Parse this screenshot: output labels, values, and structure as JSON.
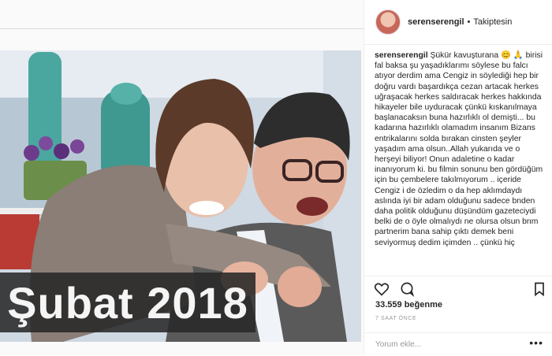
{
  "post": {
    "caption_banner": "Şubat 2018"
  },
  "author": {
    "username": "serenserengil",
    "separator": "•",
    "follow_status": "Takiptesin"
  },
  "comment": {
    "username": "serenserengil",
    "text": "Şükür kavuşturana 😊 🙏 birisi fal baksa şu yaşadıklarımı söylese bu falcı atıyor derdim ama Cengiz in söylediği hep bir doğru vardı başardıkça cezan artacak herkes uğraşacak herkes saldıracak herkes hakkında hikayeler bile uyduracak çünkü kıskanılmaya başlanacaksın buna hazırlıklı ol demişti... bu kadarına hazırlıklı olamadım insanım Bizans entrikalarını solda bırakan cinsten şeyler yaşadım ama olsun..Allah yukarıda ve o herşeyi biliyor! Onun adaletine o kadar inanıyorum ki. bu filmin sonunu ben gördüğüm için bu çembelere takılmıyorum .. içeride Cengiz i de özledim o da hep aklımdaydı aslında iyi bir adam olduğunu sadece bnden daha politik olduğunu düşündüm gazeteciydi belki de o öyle olmalıydı ne olursa olsun bnm partnerim bana sahip çıktı demek beni seviyormuş dedim içimden .. çünkü hiç"
  },
  "engagement": {
    "likes": "33.559 beğenme",
    "time": "7 SAAT ÖNCE"
  },
  "comment_input": {
    "placeholder": "Yorum ekle...",
    "more": "•••"
  },
  "icons": {
    "like": "heart-icon",
    "comment": "comment-bubble-icon",
    "save": "bookmark-icon",
    "more": "more-options-icon"
  },
  "colors": {
    "text": "#262626",
    "muted": "#999999",
    "border": "#efefef"
  }
}
